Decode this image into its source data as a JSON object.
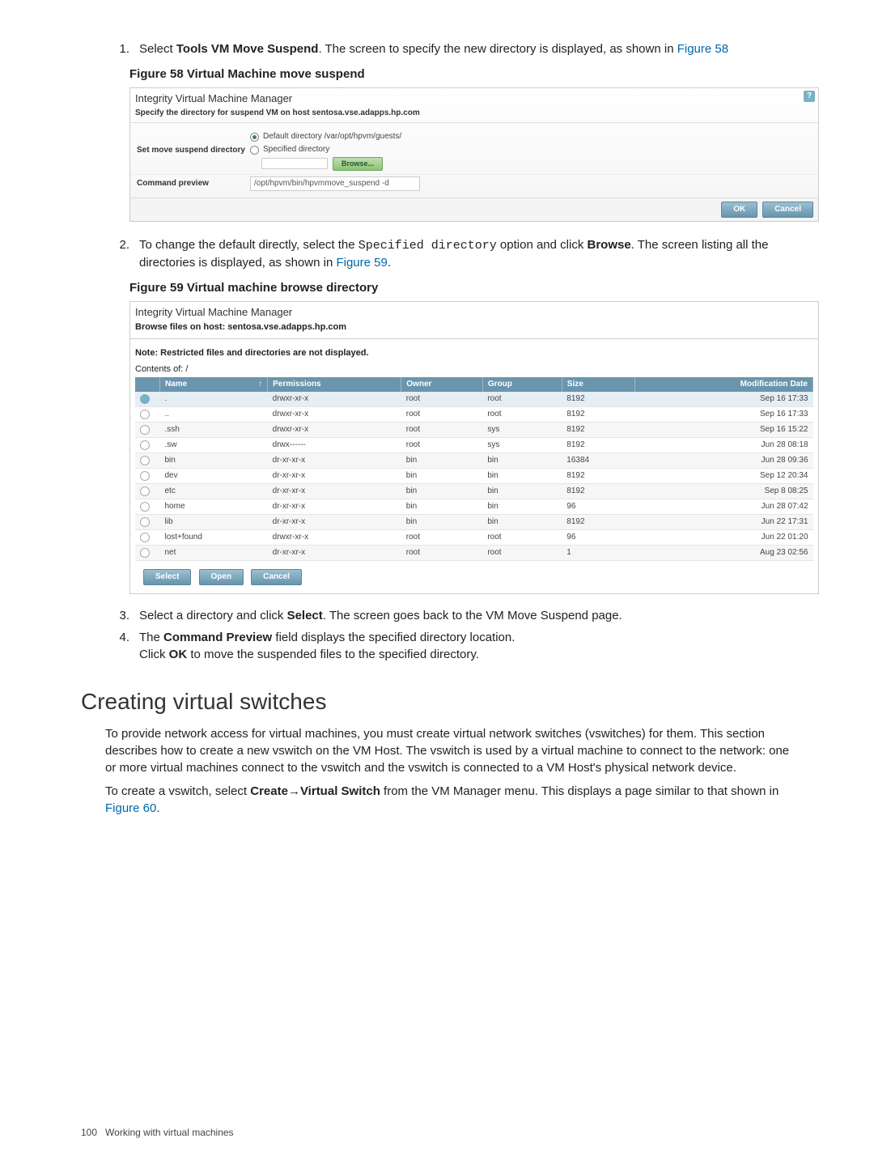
{
  "step1": {
    "num": "1.",
    "pre": "Select ",
    "boldcmd": "Tools VM Move Suspend",
    "post": ". The screen to specify the new directory is displayed, as shown in ",
    "linktext": "Figure 58"
  },
  "fig58": {
    "caption": "Figure 58 Virtual Machine move suspend",
    "title": "Integrity Virtual Machine Manager",
    "subtitle": "Specify the directory for suspend VM on host sentosa.vse.adapps.hp.com",
    "label_setdir": "Set move suspend directory",
    "opt_default": "Default directory /var/opt/hpvm/guests/",
    "opt_specified": "Specified directory",
    "browse": "Browse...",
    "label_cmd": "Command preview",
    "cmd_value": "/opt/hpvm/bin/hpvmmove_suspend -d",
    "help": "?",
    "ok": "OK",
    "cancel": "Cancel"
  },
  "step2": {
    "num": "2.",
    "pre": "To change the default directly, select the ",
    "code": "Specified directory",
    "mid": " option and click ",
    "bold": "Browse",
    "post": ". The screen listing all the directories is displayed, as shown in ",
    "link": "Figure 59",
    "tail": "."
  },
  "fig59": {
    "caption": "Figure 59 Virtual machine browse directory",
    "title": "Integrity Virtual Machine Manager",
    "subtitle": "Browse files on host: sentosa.vse.adapps.hp.com",
    "note": "Note: Restricted files and directories are not displayed.",
    "contents": "Contents of: /",
    "headers": {
      "name": "Name",
      "sort": "↑",
      "perm": "Permissions",
      "owner": "Owner",
      "group": "Group",
      "size": "Size",
      "mod": "Modification Date"
    },
    "rows": [
      {
        "sel": true,
        "name": ".",
        "perm": "drwxr-xr-x",
        "owner": "root",
        "group": "root",
        "size": "8192",
        "mod": "Sep 16 17:33"
      },
      {
        "sel": false,
        "name": "..",
        "perm": "drwxr-xr-x",
        "owner": "root",
        "group": "root",
        "size": "8192",
        "mod": "Sep 16 17:33"
      },
      {
        "sel": false,
        "name": ".ssh",
        "perm": "drwxr-xr-x",
        "owner": "root",
        "group": "sys",
        "size": "8192",
        "mod": "Sep 16 15:22"
      },
      {
        "sel": false,
        "name": ".sw",
        "perm": "drwx------",
        "owner": "root",
        "group": "sys",
        "size": "8192",
        "mod": "Jun 28 08:18"
      },
      {
        "sel": false,
        "name": "bin",
        "perm": "dr-xr-xr-x",
        "owner": "bin",
        "group": "bin",
        "size": "16384",
        "mod": "Jun 28 09:36"
      },
      {
        "sel": false,
        "name": "dev",
        "perm": "dr-xr-xr-x",
        "owner": "bin",
        "group": "bin",
        "size": "8192",
        "mod": "Sep 12 20:34"
      },
      {
        "sel": false,
        "name": "etc",
        "perm": "dr-xr-xr-x",
        "owner": "bin",
        "group": "bin",
        "size": "8192",
        "mod": "Sep 8 08:25"
      },
      {
        "sel": false,
        "name": "home",
        "perm": "dr-xr-xr-x",
        "owner": "bin",
        "group": "bin",
        "size": "96",
        "mod": "Jun 28 07:42"
      },
      {
        "sel": false,
        "name": "lib",
        "perm": "dr-xr-xr-x",
        "owner": "bin",
        "group": "bin",
        "size": "8192",
        "mod": "Jun 22 17:31"
      },
      {
        "sel": false,
        "name": "lost+found",
        "perm": "drwxr-xr-x",
        "owner": "root",
        "group": "root",
        "size": "96",
        "mod": "Jun 22 01:20"
      },
      {
        "sel": false,
        "name": "net",
        "perm": "dr-xr-xr-x",
        "owner": "root",
        "group": "root",
        "size": "1",
        "mod": "Aug 23 02:56"
      }
    ],
    "btn_select": "Select",
    "btn_open": "Open",
    "btn_cancel": "Cancel"
  },
  "step3": {
    "num": "3.",
    "pre": "Select a directory and click ",
    "bold": "Select",
    "post": ". The screen goes back to the VM Move Suspend page."
  },
  "step4": {
    "num": "4.",
    "pre": "The ",
    "bold": "Command Preview",
    "mid": " field displays the specified directory location.",
    "line2a": "Click ",
    "bold2": "OK",
    "line2b": " to move the suspended files to the specified directory."
  },
  "section": {
    "title": "Creating virtual switches",
    "p1": "To provide network access for virtual machines, you must create virtual network switches (vswitches) for them. This section describes how to create a new vswitch on the VM Host. The vswitch is used by a virtual machine to connect to the network: one or more virtual machines connect to the vswitch and the vswitch is connected to a VM Host's physical network device.",
    "p2a": "To create a vswitch, select ",
    "p2b1": "Create",
    "arrow": "→",
    "p2b2": "Virtual Switch",
    "p2c": " from the VM Manager menu. This displays a page similar to that shown in ",
    "p2link": "Figure 60",
    "p2d": "."
  },
  "footer": {
    "page": "100",
    "text": "Working with virtual machines"
  }
}
